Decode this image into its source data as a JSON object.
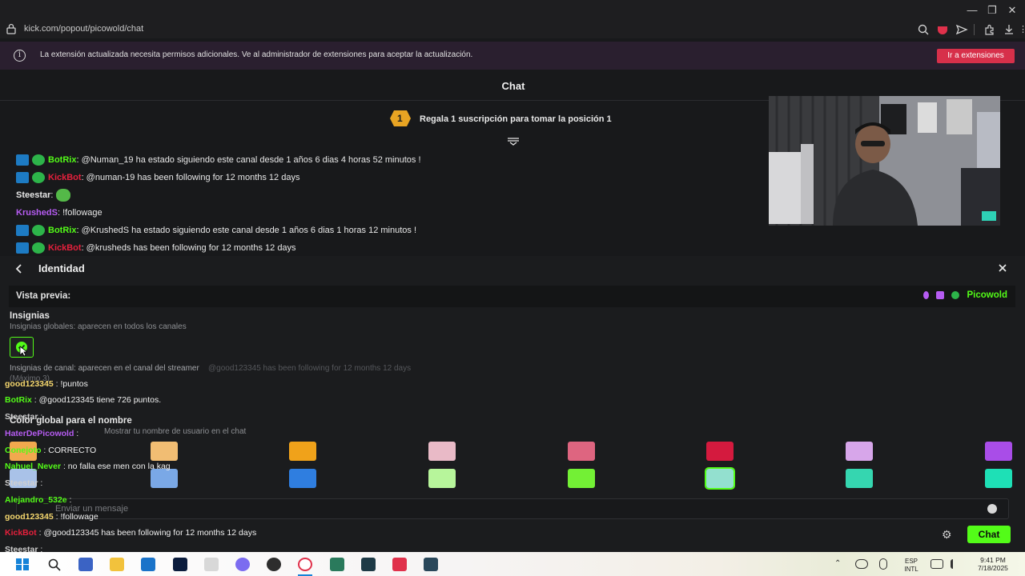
{
  "browser": {
    "url": "kick.com/popout/picowold/chat",
    "notice_text": "La extensión actualizada necesita permisos adicionales. Ve al administrador de extensiones para aceptar la actualización.",
    "notice_button": "Ir a extensiones"
  },
  "chat": {
    "title": "Chat",
    "sub_rank": "1",
    "sub_banner": "Regala 1 suscripción para tomar la posición 1",
    "messages": [
      {
        "name": "BotRix",
        "sep": ":",
        "text": " @Numan_19 ha estado siguiendo este canal desde 1 años 6 dias 4 horas 52 minutos !",
        "color": "#53fc18"
      },
      {
        "name": "KickBot",
        "sep": ":",
        "text": " @numan-19 has been following for 12 months 12 days",
        "color": "#e6203c"
      },
      {
        "name": "Steestar",
        "sep": ":",
        "text": "",
        "color": "#e6e6e6"
      },
      {
        "name": "KrushedS",
        "sep": ":",
        "text": " !followage",
        "color": "#b65cf2"
      },
      {
        "name": "BotRix",
        "sep": ":",
        "text": " @KrushedS ha estado siguiendo este canal desde 1 años 6 dias 1 horas 12 minutos !",
        "color": "#53fc18"
      },
      {
        "name": "KickBot",
        "sep": ":",
        "text": " @krusheds has been following for 12 months 12 days",
        "color": "#e6203c"
      }
    ]
  },
  "identity": {
    "back_icon": "chevron-left-icon",
    "title": "Identidad",
    "close_icon": "close-icon",
    "preview_label": "Vista previa:",
    "preview_username": "Picowold",
    "badges_title": "Insignias",
    "badges_sub": "Insignias globales: aparecen en todos los canales",
    "channel_badges_text": "Insignias de canal: aparecen en el canal del streamer",
    "channel_badges_max": "(Máximo 3)",
    "color_title": "Color global para el nombre",
    "color_sub": "Mostrar tu nombre de usuario en el chat",
    "swatch_colors": [
      "#f2a94e",
      "#f1bd73",
      "#f0a21a",
      "#e9bac7",
      "#de6580",
      "#d41a3e",
      "#d7a6ea",
      "#a94de8",
      "#a9c2e8",
      "#7aa8e6",
      "#2f7ee0",
      "#b7f59b",
      "#73f035",
      "#93e0cf",
      "#35d6b0",
      "#1ee0b6"
    ],
    "input_placeholder": "Enviar un mensaje",
    "send_button": "Chat"
  },
  "overlay_chat": [
    {
      "name": "good123345",
      "text": " : !puntos",
      "color": "#f5d76e"
    },
    {
      "name": "BotRix",
      "text": " : @good123345 tiene 726 puntos.",
      "color": "#53fc18"
    },
    {
      "name": "Steestar",
      "text": " :",
      "color": "#cfcfcf"
    },
    {
      "name": "HaterDePicowold",
      "text": " :",
      "color": "#b65cf2"
    },
    {
      "name": "Conejoto",
      "text": " : CORRECTO",
      "color": "#53fc18"
    },
    {
      "name": "Nahuel_Never",
      "text": " : no falla ese men con la kag",
      "color": "#53fc18"
    },
    {
      "name": "Steestar",
      "text": " :",
      "color": "#cfcfcf"
    },
    {
      "name": "Alejandro_532e",
      "text": " :",
      "color": "#53fc18"
    },
    {
      "name": "good123345",
      "text": " : !followage",
      "color": "#f5d76e"
    },
    {
      "name": "KickBot",
      "text": " : @good123345 has been following for 12 months 12 days",
      "color": "#e6203c"
    },
    {
      "name": "Steestar",
      "text": " :",
      "color": "#cfcfcf"
    }
  ],
  "ghost_follow_text": "@good123345 has been following for 12 months 12 days",
  "taskbar": {
    "lang": "ESP",
    "layout": "INTL",
    "time": "9:41 PM",
    "date": "7/18/2025"
  }
}
